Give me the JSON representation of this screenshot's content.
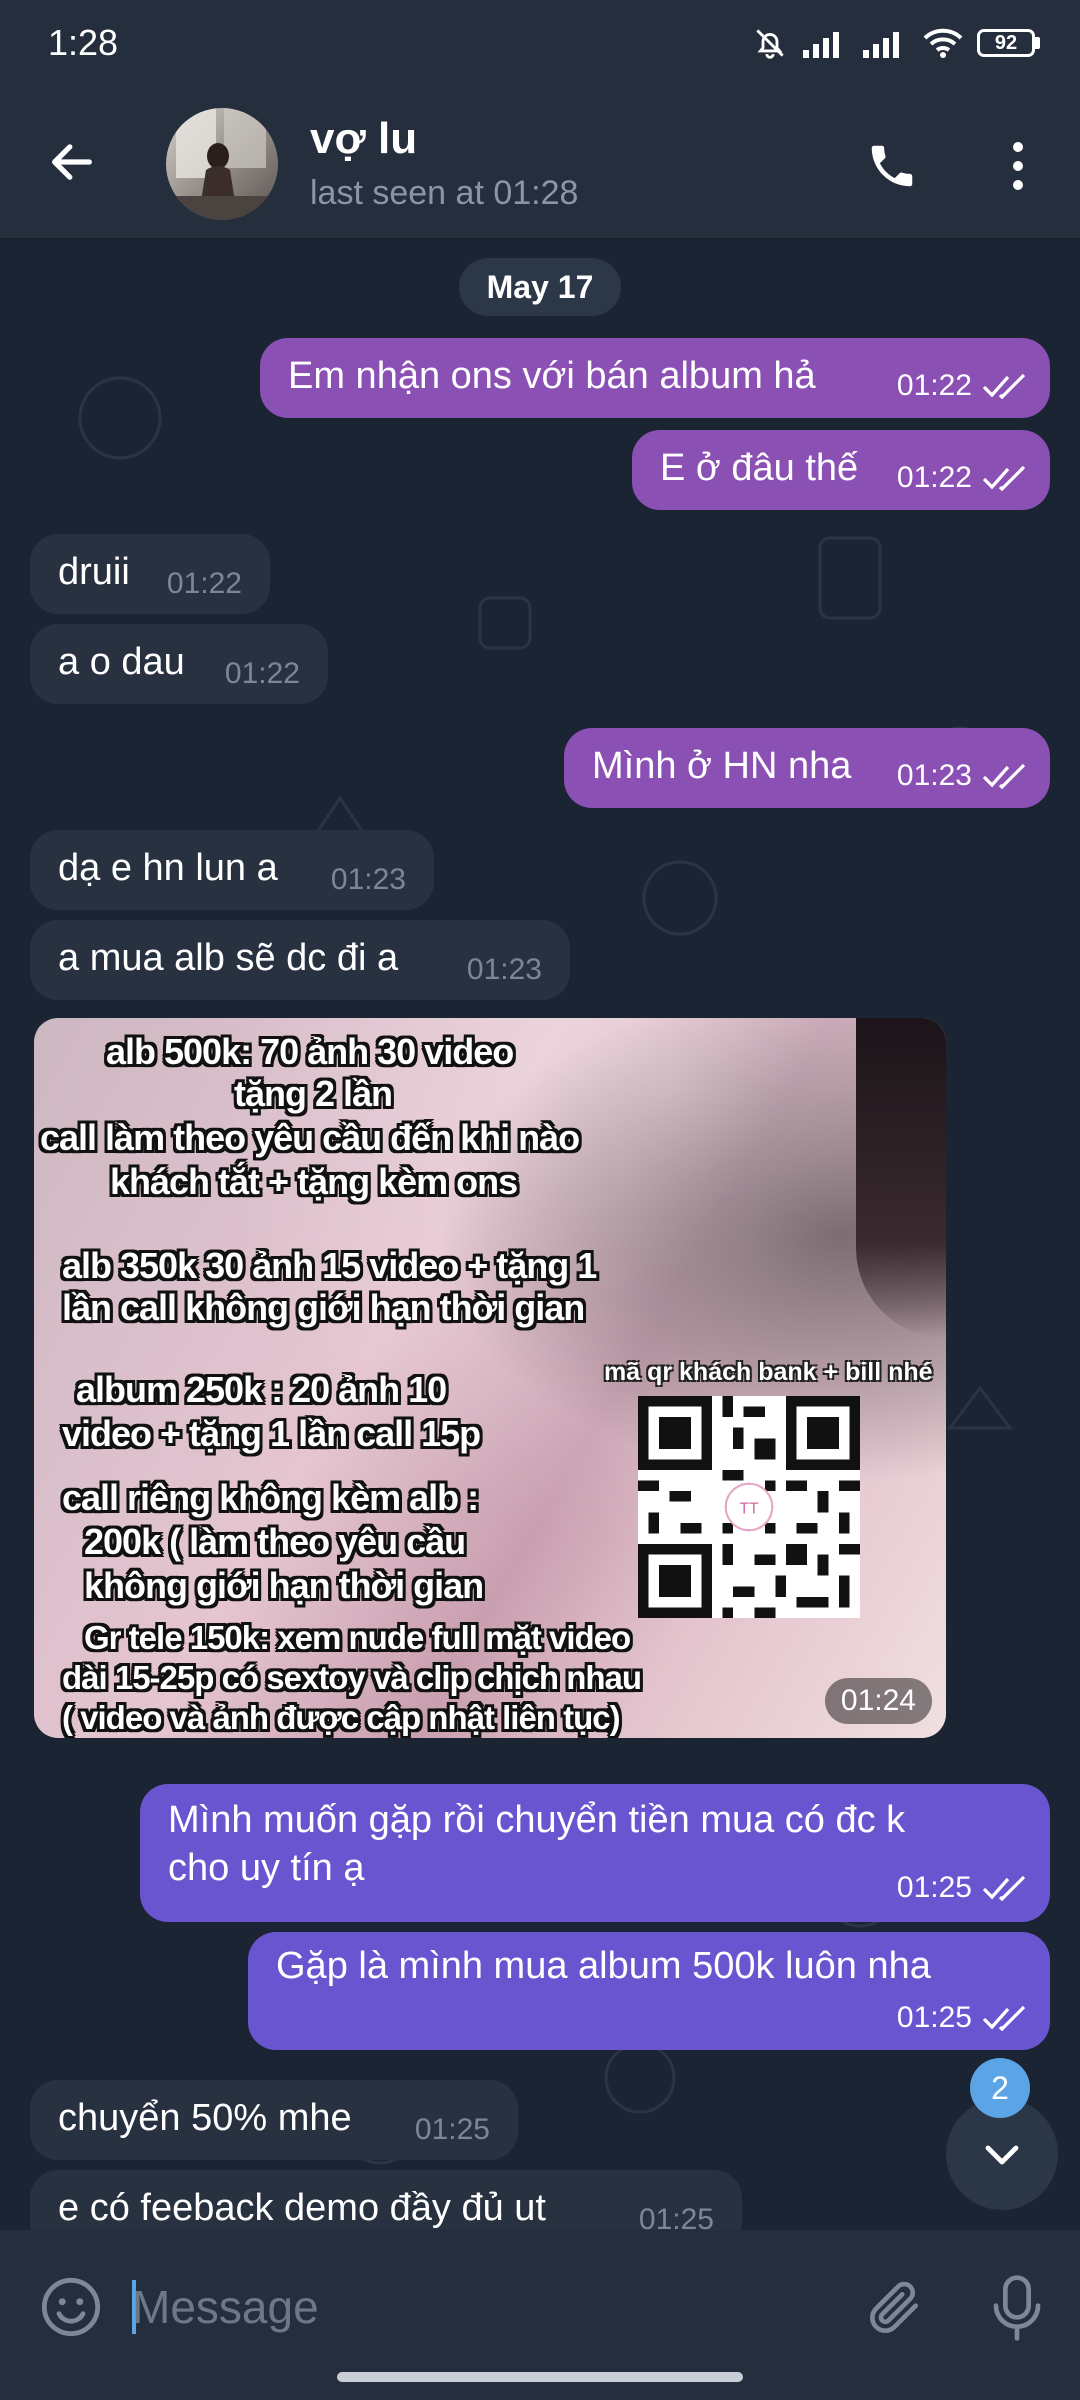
{
  "status_bar": {
    "time": "1:28",
    "battery": "92"
  },
  "header": {
    "name": "vợ lu",
    "status": "last seen at 01:28"
  },
  "chat": {
    "date_label": "May 17",
    "messages": [
      {
        "text": "Em nhận ons với bán album hả",
        "time": "01:22",
        "direction": "out"
      },
      {
        "text": "E ở đâu thế",
        "time": "01:22",
        "direction": "out"
      },
      {
        "text": "druii",
        "time": "01:22",
        "direction": "in"
      },
      {
        "text": "a o dau",
        "time": "01:22",
        "direction": "in"
      },
      {
        "text": "Mình ở HN nha",
        "time": "01:23",
        "direction": "out"
      },
      {
        "text": "dạ e hn lun a",
        "time": "01:23",
        "direction": "in"
      },
      {
        "text": "a mua alb sẽ dc đi a",
        "time": "01:23",
        "direction": "in"
      },
      {
        "text": "Mình muốn gặp rồi chuyển tiền mua có đc k\ncho uy tín ạ",
        "time": "01:25",
        "direction": "out"
      },
      {
        "text": "Gặp là mình mua album 500k luôn nha",
        "time": "01:25",
        "direction": "out"
      },
      {
        "text": "chuyển 50% mhe",
        "time": "01:25",
        "direction": "in"
      },
      {
        "text": "e có feeback demo đầy đủ ut",
        "time": "01:25",
        "direction": "in"
      }
    ],
    "image_message": {
      "time": "01:24",
      "lines": [
        "alb 500k: 70 ảnh 30 video",
        "tặng 2 lần",
        "call làm theo yêu cầu đến khi nào",
        "khách tắt + tặng kèm ons",
        "alb 350k 30 ảnh 15 video + tặng 1",
        "lần call không giới hạn thời gian",
        "album 250k  : 20 ảnh 10",
        "video + tặng 1 lần call 15p",
        "call riêng không kèm alb :",
        "200k ( làm theo yêu cầu",
        "không giới hạn thời gian",
        "Gr tele 150k: xem nude full mặt video",
        "dài 15-25p có sextoy và clip chịch nhau",
        "( video và ảnh được cập nhật liên tục)"
      ],
      "qr_caption": "mã qr khách bank + bill nhé",
      "qr_center_text": "TT"
    },
    "unread_count": "2"
  },
  "input": {
    "placeholder": "Message"
  },
  "colors": {
    "background": "#1b2433",
    "header": "#252e3d",
    "incoming_bubble": "#283140",
    "outgoing_pink": "#8b50b4",
    "outgoing_blue": "#6a55d1",
    "accent": "#5ba4e6"
  },
  "icons": [
    "back-arrow-icon",
    "phone-icon",
    "more-vertical-icon",
    "double-check-icon",
    "chevron-down-icon",
    "emoji-icon",
    "paperclip-icon",
    "microphone-icon",
    "muted-bell-icon",
    "signal-icon",
    "wifi-icon",
    "battery-icon"
  ]
}
